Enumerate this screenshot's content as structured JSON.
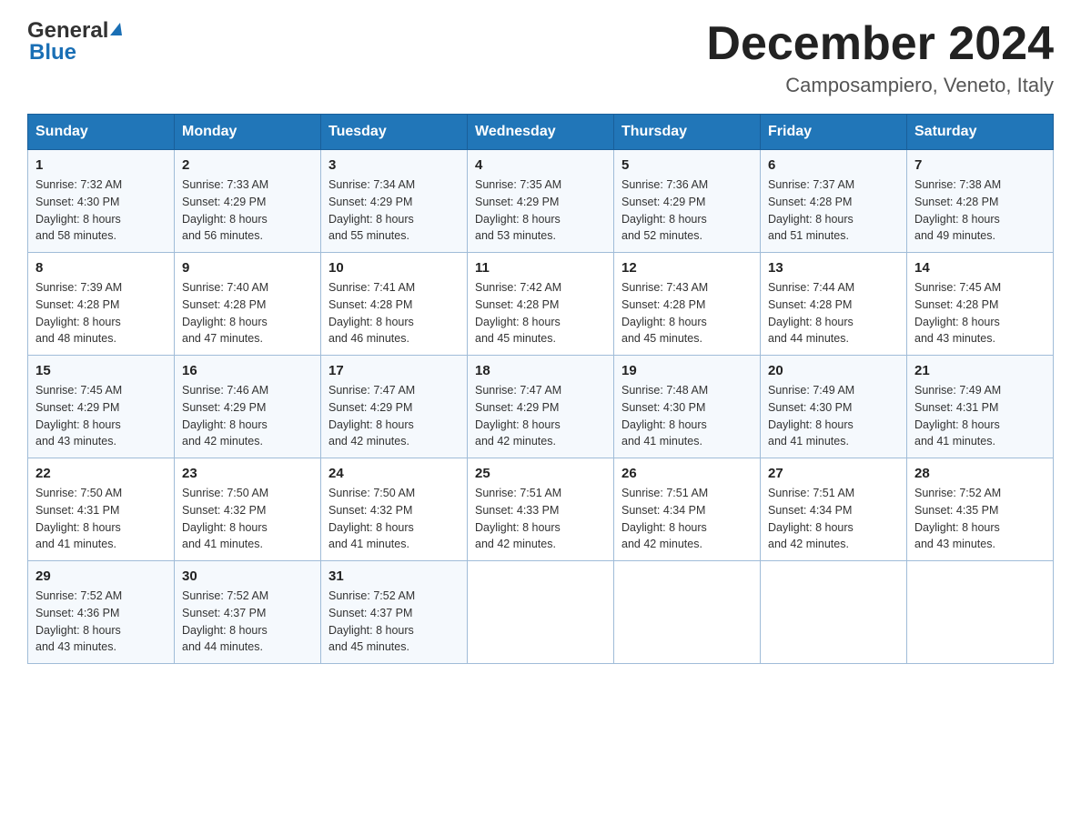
{
  "header": {
    "title": "December 2024",
    "subtitle": "Camposampiero, Veneto, Italy",
    "logo_general": "General",
    "logo_blue": "Blue"
  },
  "weekdays": [
    "Sunday",
    "Monday",
    "Tuesday",
    "Wednesday",
    "Thursday",
    "Friday",
    "Saturday"
  ],
  "weeks": [
    [
      {
        "day": "1",
        "sunrise": "7:32 AM",
        "sunset": "4:30 PM",
        "daylight": "8 hours and 58 minutes."
      },
      {
        "day": "2",
        "sunrise": "7:33 AM",
        "sunset": "4:29 PM",
        "daylight": "8 hours and 56 minutes."
      },
      {
        "day": "3",
        "sunrise": "7:34 AM",
        "sunset": "4:29 PM",
        "daylight": "8 hours and 55 minutes."
      },
      {
        "day": "4",
        "sunrise": "7:35 AM",
        "sunset": "4:29 PM",
        "daylight": "8 hours and 53 minutes."
      },
      {
        "day": "5",
        "sunrise": "7:36 AM",
        "sunset": "4:29 PM",
        "daylight": "8 hours and 52 minutes."
      },
      {
        "day": "6",
        "sunrise": "7:37 AM",
        "sunset": "4:28 PM",
        "daylight": "8 hours and 51 minutes."
      },
      {
        "day": "7",
        "sunrise": "7:38 AM",
        "sunset": "4:28 PM",
        "daylight": "8 hours and 49 minutes."
      }
    ],
    [
      {
        "day": "8",
        "sunrise": "7:39 AM",
        "sunset": "4:28 PM",
        "daylight": "8 hours and 48 minutes."
      },
      {
        "day": "9",
        "sunrise": "7:40 AM",
        "sunset": "4:28 PM",
        "daylight": "8 hours and 47 minutes."
      },
      {
        "day": "10",
        "sunrise": "7:41 AM",
        "sunset": "4:28 PM",
        "daylight": "8 hours and 46 minutes."
      },
      {
        "day": "11",
        "sunrise": "7:42 AM",
        "sunset": "4:28 PM",
        "daylight": "8 hours and 45 minutes."
      },
      {
        "day": "12",
        "sunrise": "7:43 AM",
        "sunset": "4:28 PM",
        "daylight": "8 hours and 45 minutes."
      },
      {
        "day": "13",
        "sunrise": "7:44 AM",
        "sunset": "4:28 PM",
        "daylight": "8 hours and 44 minutes."
      },
      {
        "day": "14",
        "sunrise": "7:45 AM",
        "sunset": "4:28 PM",
        "daylight": "8 hours and 43 minutes."
      }
    ],
    [
      {
        "day": "15",
        "sunrise": "7:45 AM",
        "sunset": "4:29 PM",
        "daylight": "8 hours and 43 minutes."
      },
      {
        "day": "16",
        "sunrise": "7:46 AM",
        "sunset": "4:29 PM",
        "daylight": "8 hours and 42 minutes."
      },
      {
        "day": "17",
        "sunrise": "7:47 AM",
        "sunset": "4:29 PM",
        "daylight": "8 hours and 42 minutes."
      },
      {
        "day": "18",
        "sunrise": "7:47 AM",
        "sunset": "4:29 PM",
        "daylight": "8 hours and 42 minutes."
      },
      {
        "day": "19",
        "sunrise": "7:48 AM",
        "sunset": "4:30 PM",
        "daylight": "8 hours and 41 minutes."
      },
      {
        "day": "20",
        "sunrise": "7:49 AM",
        "sunset": "4:30 PM",
        "daylight": "8 hours and 41 minutes."
      },
      {
        "day": "21",
        "sunrise": "7:49 AM",
        "sunset": "4:31 PM",
        "daylight": "8 hours and 41 minutes."
      }
    ],
    [
      {
        "day": "22",
        "sunrise": "7:50 AM",
        "sunset": "4:31 PM",
        "daylight": "8 hours and 41 minutes."
      },
      {
        "day": "23",
        "sunrise": "7:50 AM",
        "sunset": "4:32 PM",
        "daylight": "8 hours and 41 minutes."
      },
      {
        "day": "24",
        "sunrise": "7:50 AM",
        "sunset": "4:32 PM",
        "daylight": "8 hours and 41 minutes."
      },
      {
        "day": "25",
        "sunrise": "7:51 AM",
        "sunset": "4:33 PM",
        "daylight": "8 hours and 42 minutes."
      },
      {
        "day": "26",
        "sunrise": "7:51 AM",
        "sunset": "4:34 PM",
        "daylight": "8 hours and 42 minutes."
      },
      {
        "day": "27",
        "sunrise": "7:51 AM",
        "sunset": "4:34 PM",
        "daylight": "8 hours and 42 minutes."
      },
      {
        "day": "28",
        "sunrise": "7:52 AM",
        "sunset": "4:35 PM",
        "daylight": "8 hours and 43 minutes."
      }
    ],
    [
      {
        "day": "29",
        "sunrise": "7:52 AM",
        "sunset": "4:36 PM",
        "daylight": "8 hours and 43 minutes."
      },
      {
        "day": "30",
        "sunrise": "7:52 AM",
        "sunset": "4:37 PM",
        "daylight": "8 hours and 44 minutes."
      },
      {
        "day": "31",
        "sunrise": "7:52 AM",
        "sunset": "4:37 PM",
        "daylight": "8 hours and 45 minutes."
      },
      null,
      null,
      null,
      null
    ]
  ],
  "labels": {
    "sunrise": "Sunrise:",
    "sunset": "Sunset:",
    "daylight": "Daylight:"
  }
}
